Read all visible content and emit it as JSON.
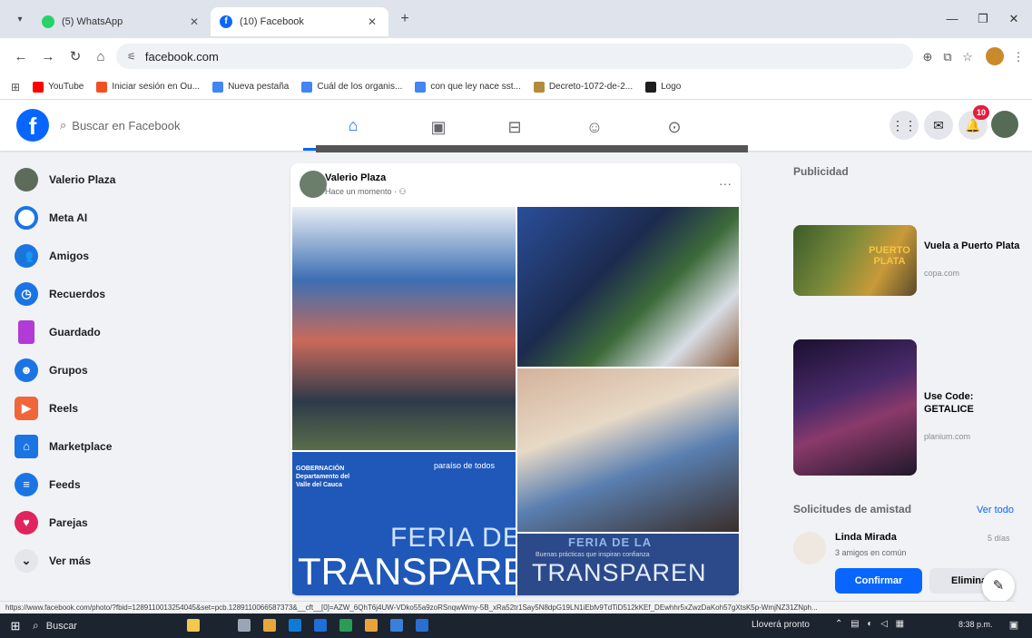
{
  "browser": {
    "tabs": [
      {
        "title": "(5) WhatsApp",
        "active": false
      },
      {
        "title": "(10) Facebook",
        "active": true
      }
    ],
    "url": "facebook.com",
    "bookmarks": [
      "YouTube",
      "Iniciar sesión en Ou...",
      "Nueva pestaña",
      "Cuál de los organis...",
      "con que ley nace sst...",
      "Decreto-1072-de-2...",
      "Logo"
    ],
    "status_url": "https://www.facebook.com/photo/?fbid=1289110013254045&set=pcb.1289110066587373&__cft__[0]=AZW_6QhT6j4UW-VDko55a9zoRSnqwWmy-5B_xRa52tr1Say5N8dpG19LN1iEbfv9TdTiD512kKEf_DEwhhr5xZwzDaKoh57gXtsK5p-WmjNZ31ZNph..."
  },
  "facebook": {
    "search_placeholder": "Buscar en Facebook",
    "notification_count": "10",
    "sidebar": [
      {
        "label": "Valerio Plaza",
        "icon": "profile-avatar",
        "color": "#5d6b5a"
      },
      {
        "label": "Meta AI",
        "icon": "meta-ai-icon",
        "color": "#ffffff"
      },
      {
        "label": "Amigos",
        "icon": "friends-icon",
        "color": "#1b74e4"
      },
      {
        "label": "Recuerdos",
        "icon": "memories-icon",
        "color": "#1b74e4"
      },
      {
        "label": "Guardado",
        "icon": "saved-icon",
        "color": "#b13bd6"
      },
      {
        "label": "Grupos",
        "icon": "groups-icon",
        "color": "#1b74e4"
      },
      {
        "label": "Reels",
        "icon": "reels-icon",
        "color": "#f0653a"
      },
      {
        "label": "Marketplace",
        "icon": "marketplace-icon",
        "color": "#1b74e4"
      },
      {
        "label": "Feeds",
        "icon": "feeds-icon",
        "color": "#1b74e4"
      },
      {
        "label": "Parejas",
        "icon": "dating-icon",
        "color": "#e0245e"
      },
      {
        "label": "Ver más",
        "icon": "chevron-down-icon",
        "color": "#e4e6eb"
      }
    ],
    "post": {
      "author": "Valerio Plaza",
      "time": "Hace un momento · ⚇",
      "banner": {
        "gobernacion": "GOBERNACIÓN Departamento del Valle del Cauca",
        "paraiso": "paraíso de todos",
        "feria": "FERIA DE",
        "transparencia": "TRANSPARE",
        "feria2": "FERIA DE LA",
        "sub": "Buenas prácticas que inspiran confianza",
        "transparencia2": "TRANSPAREN"
      }
    },
    "right": {
      "ads_title": "Publicidad",
      "ads": [
        {
          "title": "Vuela a Puerto Plata",
          "domain": "copa.com",
          "image_text": "PUERTO PLATA"
        },
        {
          "title": "Use Code: GETALICE",
          "domain": "planium.com"
        }
      ],
      "requests_title": "Solicitudes de amistad",
      "see_all": "Ver todo",
      "request": {
        "name": "Linda Mirada",
        "days": "5 días",
        "mutual": "3 amigos en común",
        "confirm": "Confirmar",
        "delete": "Eliminar"
      }
    }
  },
  "taskbar": {
    "search_label": "Buscar",
    "weather": "Lloverá pronto",
    "time": "8:38 p.m."
  }
}
